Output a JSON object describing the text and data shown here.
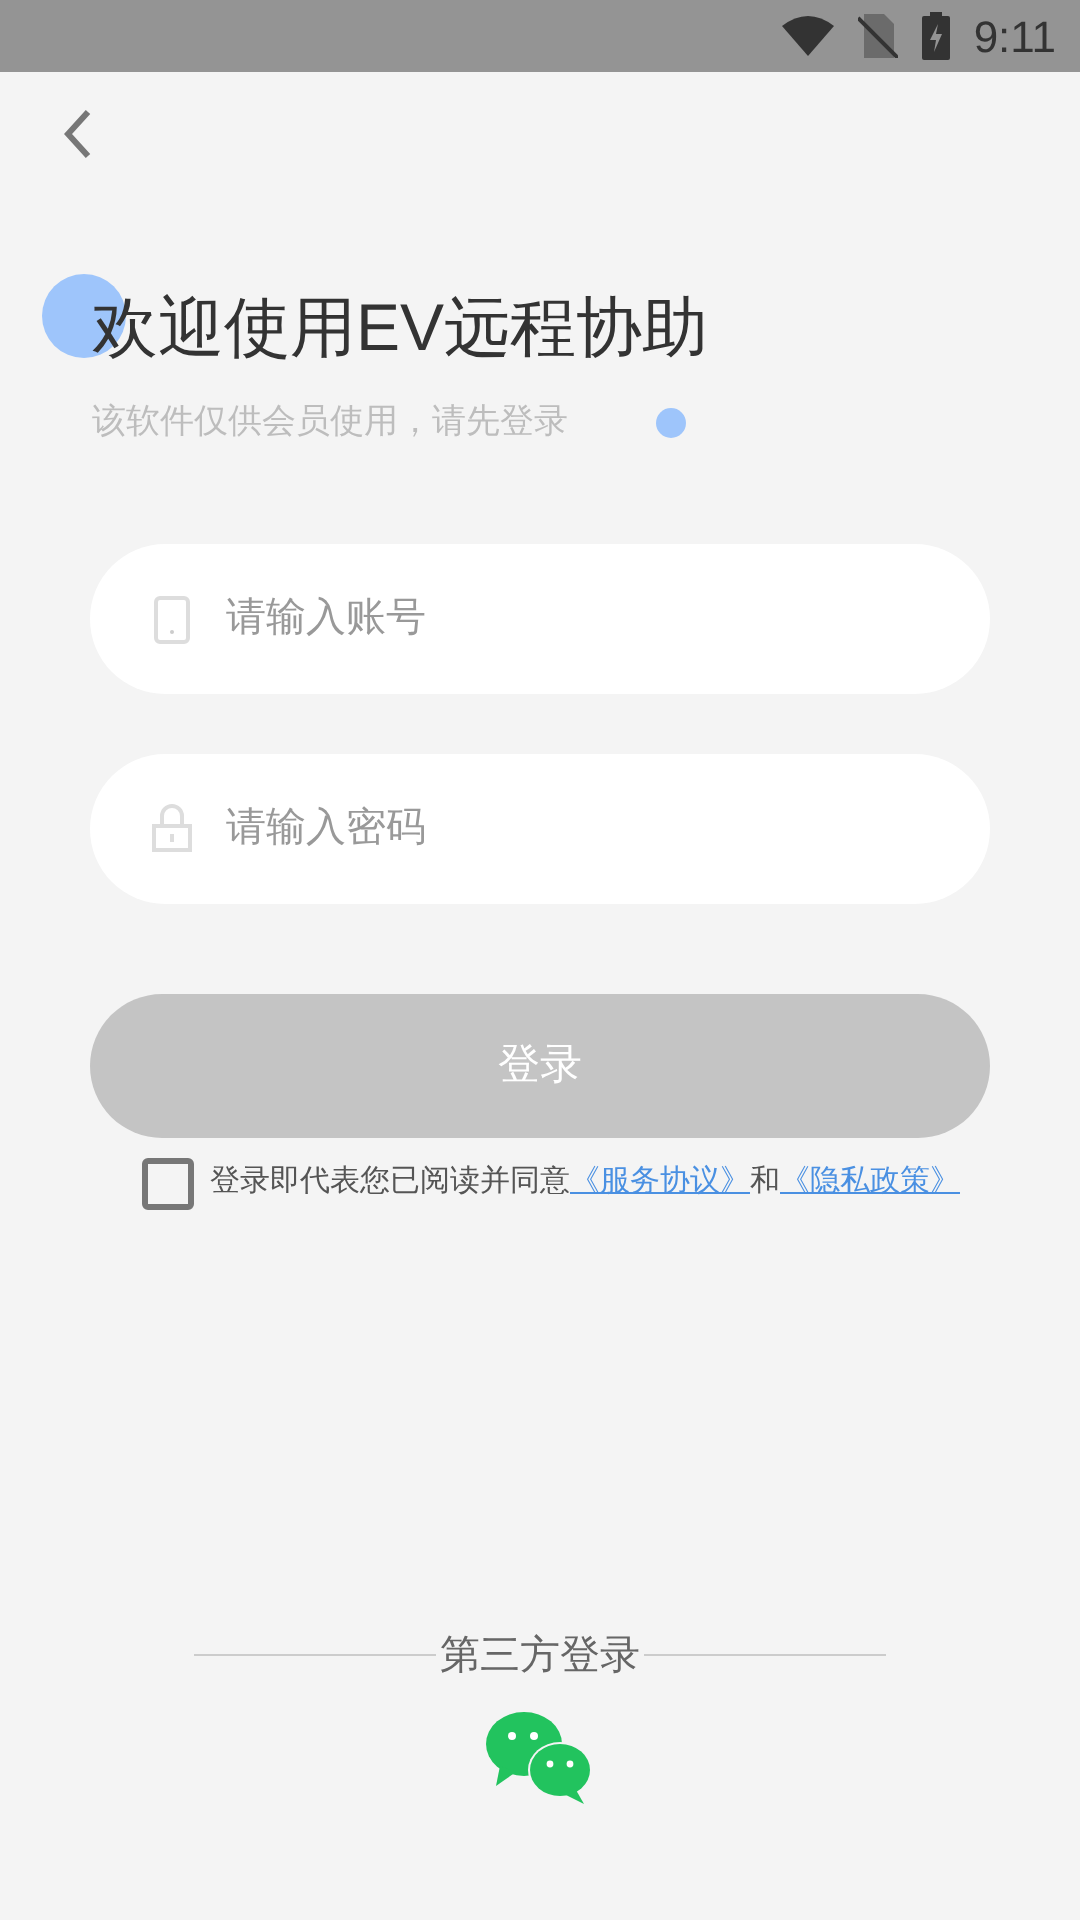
{
  "status_bar": {
    "time": "9:11"
  },
  "title": "欢迎使用EV远程协助",
  "subtitle": "该软件仅供会员使用，请先登录",
  "account_field": {
    "placeholder": "请输入账号"
  },
  "password_field": {
    "placeholder": "请输入密码"
  },
  "login_button": {
    "label": "登录",
    "disabled": true
  },
  "agreement": {
    "checked": false,
    "text": "登录即代表您已阅读并同意",
    "terms_link": "《服务协议》",
    "conjunction": "和",
    "privacy_link": "《隐私政策》"
  },
  "third_party": {
    "label": "第三方登录"
  }
}
